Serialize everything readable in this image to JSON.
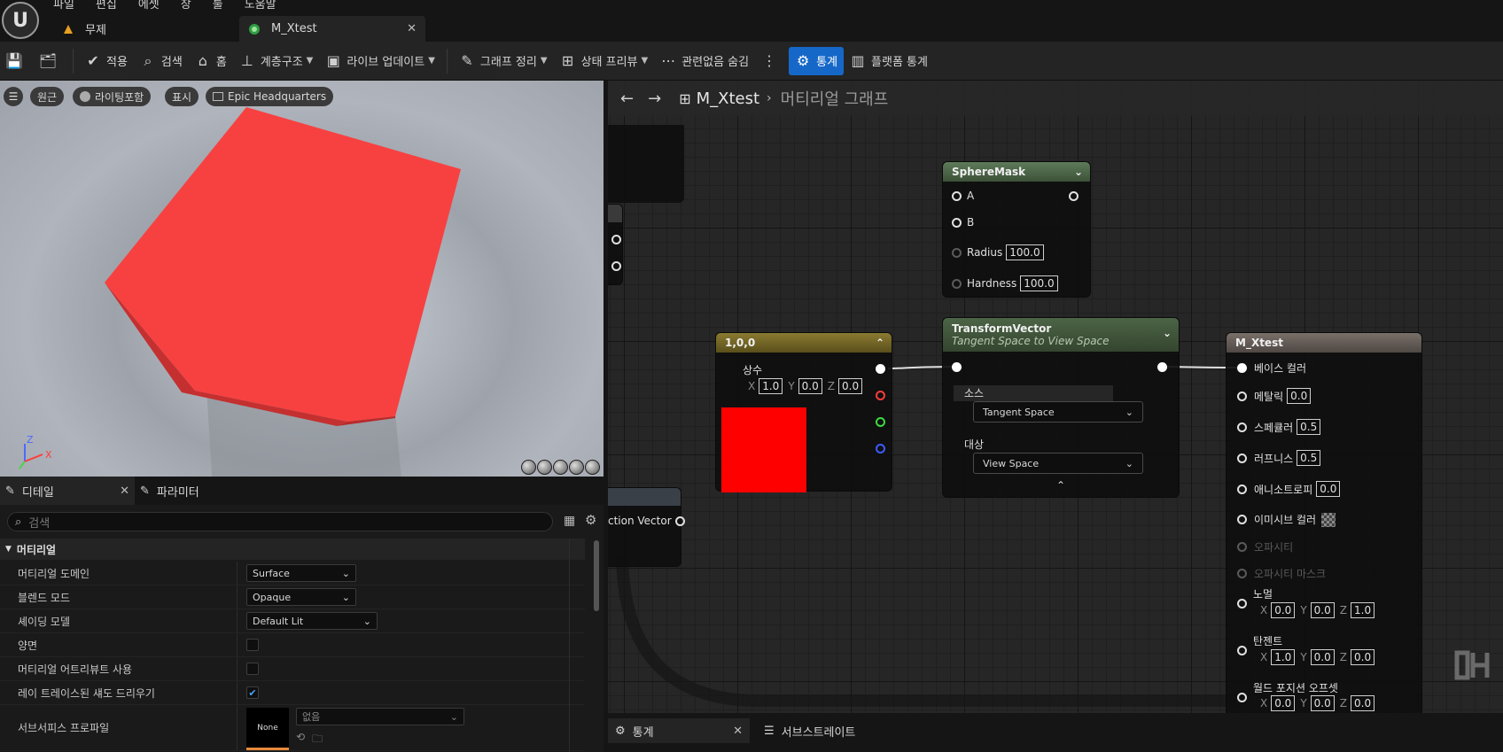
{
  "menu": [
    "파일",
    "편집",
    "에셋",
    "창",
    "툴",
    "도움말"
  ],
  "tabs": {
    "untitled": "무제",
    "material": "M_Xtest"
  },
  "toolbar": {
    "apply": "적용",
    "search": "검색",
    "home": "홈",
    "hierarchy": "계층구조",
    "live_update": "라이브 업데이트",
    "graph_cleanup": "그래프 정리",
    "state_preview": "상태 프리뷰",
    "hide_unrelated": "관련없음 숨김",
    "stats": "통계",
    "platform_stats": "플랫폼 통계"
  },
  "viewport": {
    "perspective": "원근",
    "lit": "라이팅포함",
    "show": "표시",
    "env": "Epic Headquarters"
  },
  "details": {
    "tab_details": "디테일",
    "tab_params": "파라미터",
    "search_placeholder": "검색",
    "section": "머티리얼",
    "rows": [
      {
        "label": "머티리얼 도메인",
        "value": "Surface"
      },
      {
        "label": "블렌드 모드",
        "value": "Opaque"
      },
      {
        "label": "셰이딩 모델",
        "value": "Default Lit"
      },
      {
        "label": "양면"
      },
      {
        "label": "머티리얼 어트리뷰트 사용"
      },
      {
        "label": "레이 트레이스된 섀도 드리우기",
        "checked": true
      },
      {
        "label": "서브서피스 프로파일",
        "value": "없음",
        "thumb": "None"
      }
    ]
  },
  "graph": {
    "title": "M_Xtest",
    "subtitle": "머티리얼 그래프",
    "partial_node_label": "ction Vector",
    "sphere_mask": {
      "title": "SphereMask",
      "a": "A",
      "b": "B",
      "radius_label": "Radius",
      "radius": "100.0",
      "hardness_label": "Hardness",
      "hardness": "100.0"
    },
    "constant": {
      "title": "1,0,0",
      "label": "상수",
      "x": "1.0",
      "y": "0.0",
      "z": "0.0",
      "color": "#ff0000"
    },
    "transform": {
      "title": "TransformVector",
      "subtitle": "Tangent Space to View Space",
      "source_label": "소스",
      "source": "Tangent Space",
      "dest_label": "대상",
      "dest": "View Space"
    },
    "result": {
      "title": "M_Xtest",
      "base_color": "베이스 컬러",
      "metallic": "메탈릭",
      "metallic_v": "0.0",
      "specular": "스페큘러",
      "specular_v": "0.5",
      "roughness": "러프니스",
      "roughness_v": "0.5",
      "anisotropy": "애니소트로피",
      "anisotropy_v": "0.0",
      "emissive": "이미시브 컬러",
      "opacity": "오파시티",
      "opacity_mask": "오파시티 마스크",
      "normal": "노멀",
      "normal_x": "0.0",
      "normal_y": "0.0",
      "normal_z": "1.0",
      "tangent": "탄젠트",
      "tangent_x": "1.0",
      "tangent_y": "0.0",
      "tangent_z": "0.0",
      "wpo": "월드 포지션 오프셋",
      "wpo_x": "0.0",
      "wpo_y": "0.0",
      "wpo_z": "0.0"
    }
  },
  "bottom": {
    "stats": "통계",
    "substrate": "서브스트레이트"
  },
  "axis": {
    "x": "X",
    "z": "Z"
  }
}
